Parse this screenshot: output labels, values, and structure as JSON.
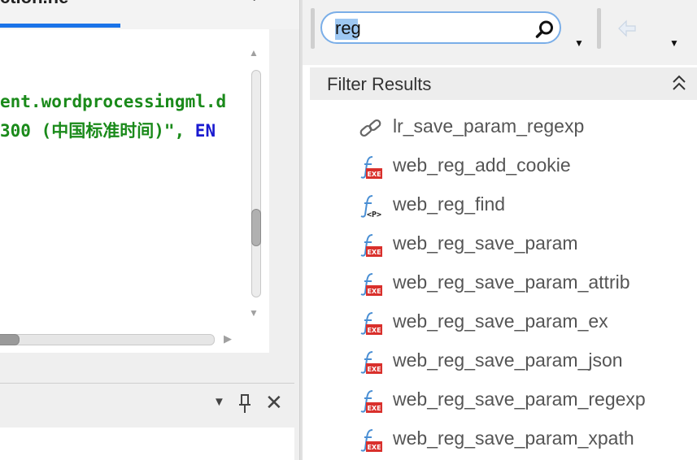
{
  "left_pane": {
    "tab_title": "ction.ne",
    "code_lines": [
      "ent.wordprocessingml.d",
      "300 (中国标准时间)\", "
    ],
    "code_enum": "EN"
  },
  "search": {
    "value": "reg",
    "placeholder": ""
  },
  "filter": {
    "title": "Filter Results"
  },
  "results": [
    {
      "label": "lr_save_param_regexp",
      "icon": "link-icon"
    },
    {
      "label": "web_reg_add_cookie",
      "icon": "exe-function-icon"
    },
    {
      "label": "web_reg_find",
      "icon": "p-function-icon"
    },
    {
      "label": "web_reg_save_param",
      "icon": "exe-function-icon"
    },
    {
      "label": "web_reg_save_param_attrib",
      "icon": "exe-function-icon"
    },
    {
      "label": "web_reg_save_param_ex",
      "icon": "exe-function-icon"
    },
    {
      "label": "web_reg_save_param_json",
      "icon": "exe-function-icon"
    },
    {
      "label": "web_reg_save_param_regexp",
      "icon": "exe-function-icon"
    },
    {
      "label": "web_reg_save_param_xpath",
      "icon": "exe-function-icon"
    }
  ],
  "colors": {
    "accent": "#1a73e8",
    "code_string": "#1a8a1a",
    "code_keyword": "#1a1ad0",
    "exe_badge": "#d9302c",
    "search_border": "#7aaee8"
  }
}
